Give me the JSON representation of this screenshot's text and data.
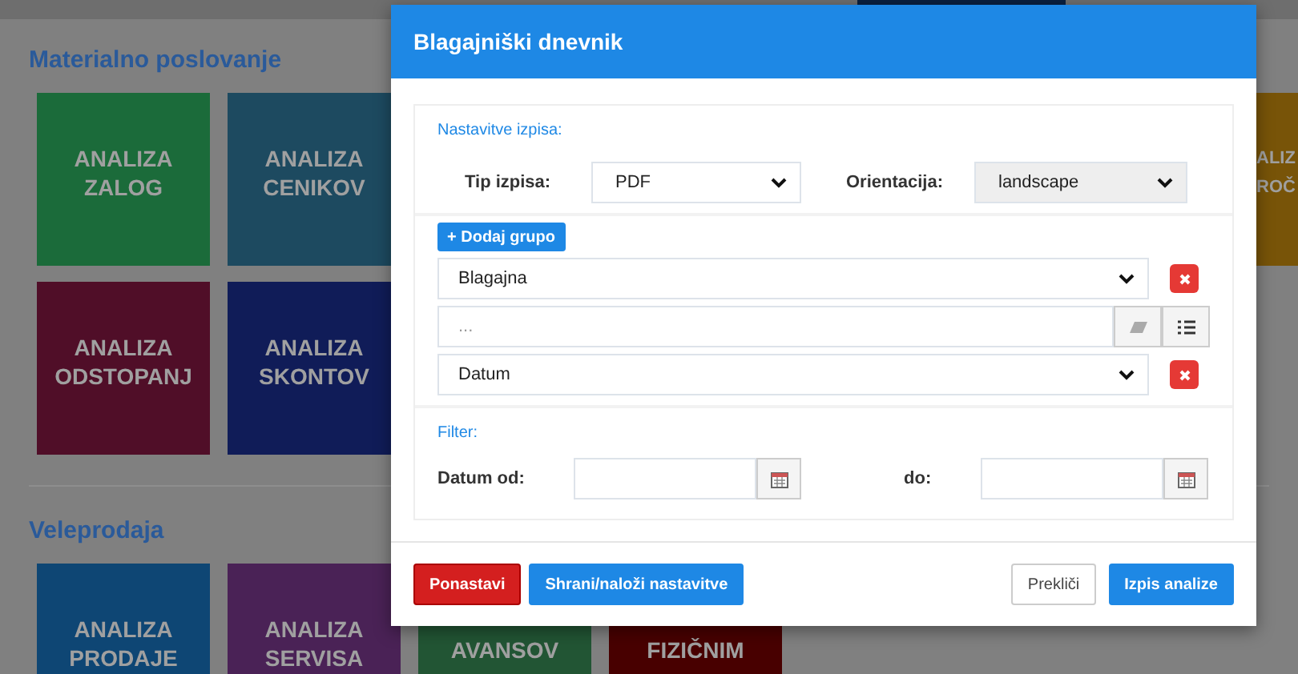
{
  "background": {
    "sections": [
      {
        "title": "Materialno poslovanje",
        "rows": [
          {
            "tiles": [
              {
                "lines": [
                  "ANALIZA",
                  "ZALOG"
                ],
                "color": "#1b6b3a"
              },
              {
                "lines": [
                  "ANALIZA",
                  "CENIKOV"
                ],
                "color": "#1d4a60"
              }
            ],
            "side_tile": {
              "lines": [
                "ALIZ",
                "ROČ"
              ],
              "color": "#785408"
            }
          },
          {
            "tiles": [
              {
                "lines": [
                  "ANALIZA",
                  "ODSTOPANJ"
                ],
                "color": "#500e28"
              },
              {
                "lines": [
                  "ANALIZA",
                  "SKONTOV"
                ],
                "color": "#101c58"
              }
            ]
          }
        ]
      },
      {
        "title": "Veleprodaja",
        "rows": [
          {
            "tiles": [
              {
                "lines": [
                  "ANALIZA",
                  "PRODAJE"
                ],
                "color": "#0e4674"
              },
              {
                "lines": [
                  "ANALIZA",
                  "SERVISA"
                ],
                "color": "#4a2256"
              },
              {
                "lines": [
                  "AVANSOV"
                ],
                "color": "#225534"
              },
              {
                "lines": [
                  "FIZIČNIM"
                ],
                "color": "#480000"
              }
            ]
          }
        ]
      }
    ]
  },
  "dialog": {
    "title": "Blagajniški dnevnik",
    "settings": {
      "heading": "Nastavitve izpisa:",
      "type_label": "Tip izpisa:",
      "type_value": "PDF",
      "orientation_label": "Orientacija:",
      "orientation_value": "landscape",
      "orientation_disabled": true
    },
    "groups": {
      "add_button": "+ Dodaj grupo",
      "rows": [
        {
          "kind": "select",
          "value": "Blagajna"
        },
        {
          "kind": "input",
          "placeholder": "..."
        },
        {
          "kind": "select",
          "value": "Datum"
        }
      ]
    },
    "filter": {
      "heading": "Filter:",
      "from_label": "Datum od:",
      "to_label": "do:"
    },
    "footer": {
      "left": [
        {
          "label": "Ponastavi",
          "kind": "danger"
        },
        {
          "label": "Shrani/naloži nastavitve",
          "kind": "primary"
        }
      ],
      "right": [
        {
          "label": "Prekliči",
          "kind": "default"
        },
        {
          "label": "Izpis analize",
          "kind": "primary"
        }
      ]
    }
  }
}
